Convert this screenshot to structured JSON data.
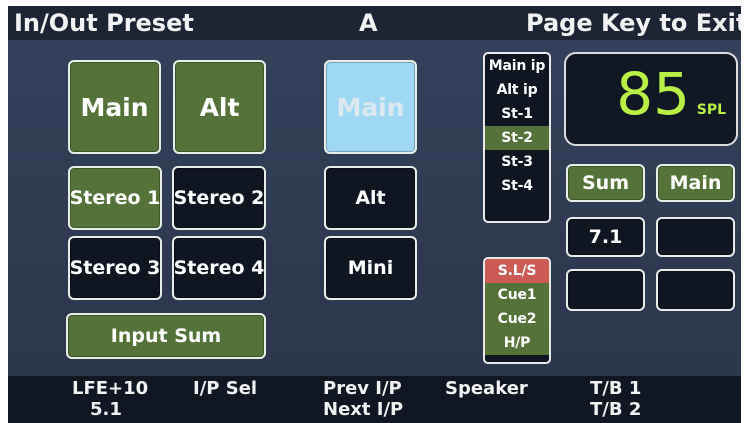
{
  "header": {
    "title": "In/Out Preset",
    "preset": "A",
    "exit_hint": "Page Key to Exit"
  },
  "buttons": {
    "main": "Main",
    "alt": "Alt",
    "selected_main": "Main",
    "stereo_1": "Stereo 1",
    "stereo_2": "Stereo 2",
    "stereo_3": "Stereo 3",
    "stereo_4": "Stereo 4",
    "input_sum": "Input Sum",
    "output_alt": "Alt",
    "output_mini": "Mini",
    "sum": "Sum",
    "speaker_main": "Main",
    "format": "7.1",
    "empty_1": "",
    "empty_2": "",
    "empty_3": ""
  },
  "input_list": [
    "Main ip",
    "Alt ip",
    "St-1",
    "St-2",
    "St-3",
    "St-4"
  ],
  "cue_list": [
    "S.L/S",
    "Cue1",
    "Cue2",
    "H/P"
  ],
  "meter": {
    "value": "85",
    "unit": "SPL"
  },
  "softkeys": {
    "lfe": "LFE+10",
    "format": "5.1",
    "ip_sel": "I/P Sel",
    "prev_ip": "Prev I/P",
    "next_ip": "Next I/P",
    "speaker": "Speaker",
    "tb1": "T/B 1",
    "tb2": "T/B 2"
  },
  "colors": {
    "active_green": "#557238",
    "selected_blue": "#9fd8f4",
    "meter_green": "#b8f046",
    "warning_red": "#cc5b56"
  }
}
